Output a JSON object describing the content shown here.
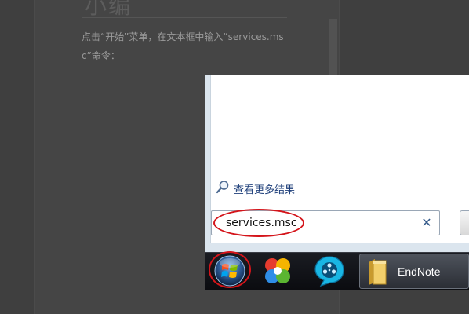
{
  "document": {
    "heading": "小编",
    "instruction": "点击“开始”菜单，在文本框中输入“services.msc”命令："
  },
  "start_menu": {
    "see_more_label": "查看更多结果",
    "search_value": "services.msc",
    "clear_symbol": "✕"
  },
  "taskbar": {
    "apps": [
      {
        "icon": "start-orb-icon"
      },
      {
        "icon": "pinwheel-app-icon"
      },
      {
        "icon": "video-player-icon"
      },
      {
        "icon": "folder-icon",
        "label": "EndNote"
      }
    ]
  },
  "colors": {
    "highlight": "#d4141a",
    "link": "#1e3f7a"
  }
}
